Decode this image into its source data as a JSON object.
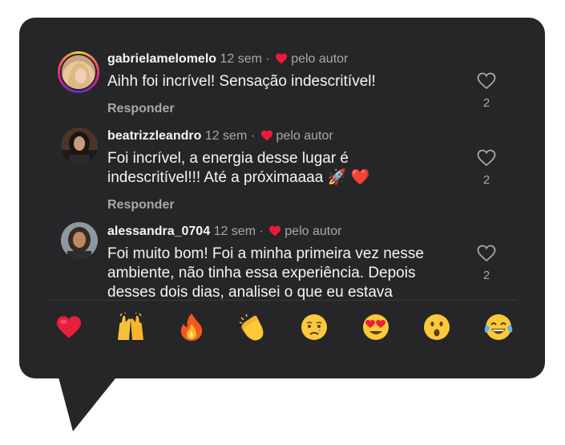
{
  "comments": [
    {
      "username": "gabrielamelomelo",
      "time": "12 sem",
      "separator": "·",
      "liked_by_author": "pelo autor",
      "text": "Aihh foi incrível! Sensação indescritível!",
      "reply_label": "Responder",
      "likes": "2",
      "avatar": "avatar-blonde-woman"
    },
    {
      "username": "beatrizzleandro",
      "time": "12 sem",
      "separator": "·",
      "liked_by_author": "pelo autor",
      "text_line1": "Foi incrível, a energia desse lugar é",
      "text_line2": "indescritível!!! Até a próximaaaa",
      "text_emojis": "🚀 ❤️",
      "reply_label": "Responder",
      "likes": "2",
      "avatar": "avatar-dark-hair-woman"
    },
    {
      "username": "alessandra_0704",
      "time": "12 sem",
      "separator": "·",
      "liked_by_author": "pelo autor",
      "text_line1": "Foi muito bom! Foi a minha primeira vez nesse",
      "text_line2": "ambiente, não tinha essa experiência. Depois",
      "text_line3": "desses dois dias, analisei o que eu estava",
      "likes": "2",
      "avatar": "avatar-brown-hair-woman"
    }
  ],
  "reactions": [
    "❤️",
    "🙌",
    "🔥",
    "👏",
    "😢",
    "😍",
    "😮",
    "😂"
  ],
  "colors": {
    "background": "#262628",
    "text": "#f5f5f5",
    "muted": "#a8a8a8",
    "heart": "#ed1a3a"
  }
}
